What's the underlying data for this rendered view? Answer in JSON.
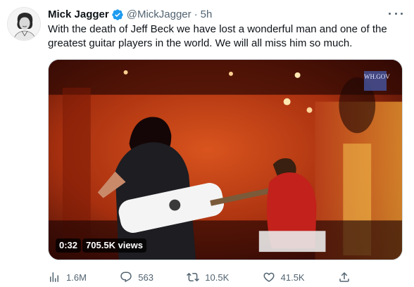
{
  "author": {
    "name": "Mick Jagger",
    "handle": "@MickJagger",
    "separator": "·",
    "time": "5h",
    "verified": true
  },
  "tweet": {
    "text": "With the death of Jeff Beck we have lost a wonderful man and one of the greatest guitar players in the world. We will all miss him so much."
  },
  "media": {
    "type": "video",
    "duration": "0:32",
    "views": "705.5K views",
    "watermark": "WH.GOV"
  },
  "actions": {
    "views": "1.6M",
    "replies": "563",
    "retweets": "10.5K",
    "likes": "41.5K"
  },
  "colors": {
    "accent": "#1d9bf0",
    "secondary_text": "#536471",
    "primary_text": "#0f1419"
  }
}
